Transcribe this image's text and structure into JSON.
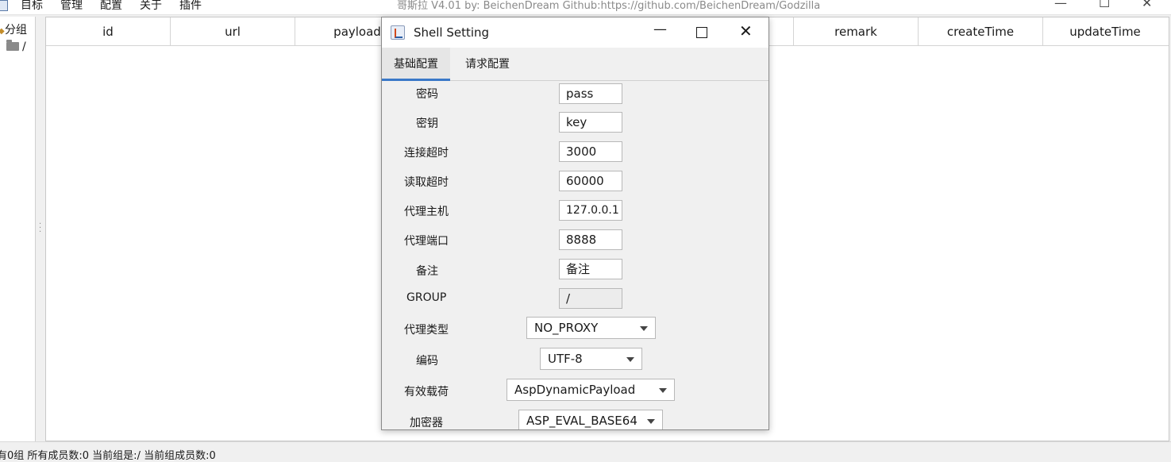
{
  "menu": {
    "items": [
      "目标",
      "管理",
      "配置",
      "关于",
      "插件"
    ]
  },
  "window": {
    "title": "哥斯拉   V4.01 by: BeichenDream Github:https://github.com/BeichenDream/Godzilla",
    "minimize": "—",
    "maximize": "☐",
    "close": "✕"
  },
  "tree": {
    "root_label": "分组",
    "child_label": "/"
  },
  "table": {
    "columns": [
      "id",
      "url",
      "payload",
      "",
      "",
      "",
      "remark",
      "createTime",
      "updateTime"
    ]
  },
  "status": {
    "text": "有0组 所有成员数:0 当前组是:/ 当前组成员数:0"
  },
  "dialog": {
    "title": "Shell Setting",
    "minimize": "—",
    "close": "✕",
    "tabs": [
      "基础配置",
      "请求配置"
    ],
    "fields": {
      "password": {
        "label": "密码",
        "value": "pass"
      },
      "secret_key": {
        "label": "密钥",
        "value": "key"
      },
      "connect_timeout": {
        "label": "连接超时",
        "value": "3000"
      },
      "read_timeout": {
        "label": "读取超时",
        "value": "60000"
      },
      "proxy_host": {
        "label": "代理主机",
        "value": "127.0.0.1"
      },
      "proxy_port": {
        "label": "代理端口",
        "value": "8888"
      },
      "remark": {
        "label": "备注",
        "value": "备注"
      },
      "group": {
        "label": "GROUP",
        "value": "/"
      },
      "proxy_type": {
        "label": "代理类型",
        "value": "NO_PROXY"
      },
      "encoding": {
        "label": "编码",
        "value": "UTF-8"
      },
      "payload": {
        "label": "有效载荷",
        "value": "AspDynamicPayload"
      },
      "cryption": {
        "label": "加密器",
        "value": "ASP_EVAL_BASE64"
      }
    }
  }
}
